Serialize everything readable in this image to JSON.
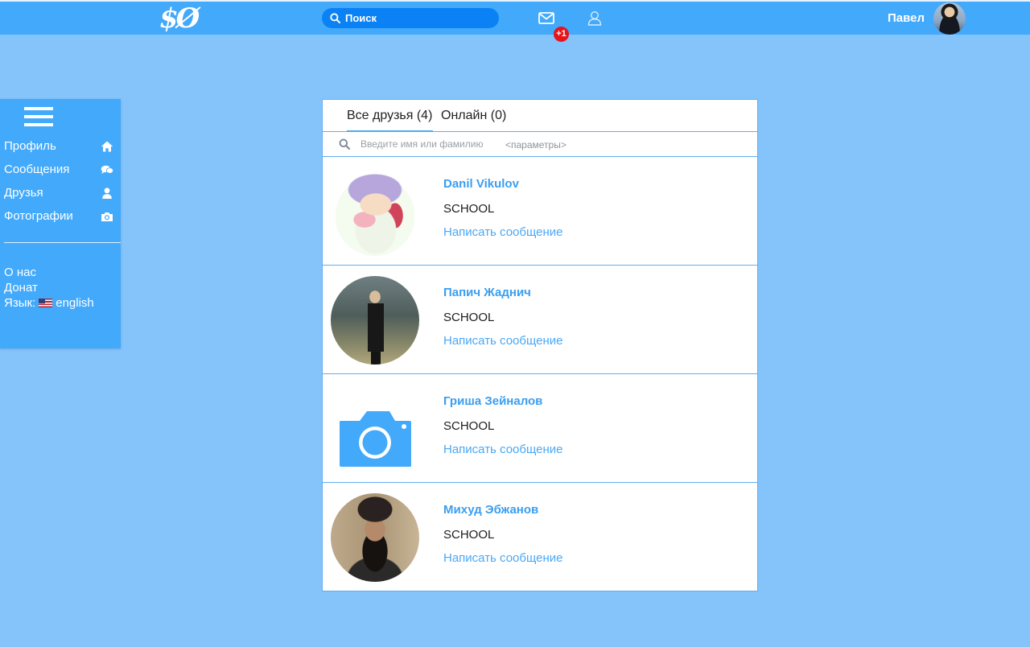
{
  "header": {
    "logo_text": "$Ø",
    "search_placeholder": "Поиск",
    "mail_badge": "+1",
    "user_name": "Павел"
  },
  "sidebar": {
    "nav": [
      {
        "label": "Профиль",
        "icon": "home-icon"
      },
      {
        "label": "Сообщения",
        "icon": "chat-icon"
      },
      {
        "label": "Друзья",
        "icon": "person-icon"
      },
      {
        "label": "Фотографии",
        "icon": "camera-icon"
      }
    ],
    "footer": {
      "about": "О нас",
      "donate": "Донат",
      "language_label": "Язык:",
      "language_value": "english"
    }
  },
  "friends": {
    "tabs": [
      {
        "label": "Все друзья (4)",
        "active": true
      },
      {
        "label": "Онлайн (0)",
        "active": false
      }
    ],
    "search_placeholder": "Введите имя или фамилию",
    "params_label": "<параметры>",
    "list": [
      {
        "name": "Danil Vikulov",
        "school": "SCHOOL",
        "action": "Написать сообщение",
        "avatar": "anime-avatar"
      },
      {
        "name": "Папич Жаднич",
        "school": "SCHOOL",
        "action": "Написать сообщение",
        "avatar": "photo-avatar"
      },
      {
        "name": "Гриша Зейналов",
        "school": "SCHOOL",
        "action": "Написать сообщение",
        "avatar": "camera-placeholder-icon"
      },
      {
        "name": "Михуд Эбжанов",
        "school": "SCHOOL",
        "action": "Написать сообщение",
        "avatar": "photo-avatar"
      }
    ]
  },
  "colors": {
    "page_bg": "#84c4fb",
    "header_bg": "#42a9fb",
    "accent": "#4aa8f5",
    "badge": "#e8141b"
  }
}
